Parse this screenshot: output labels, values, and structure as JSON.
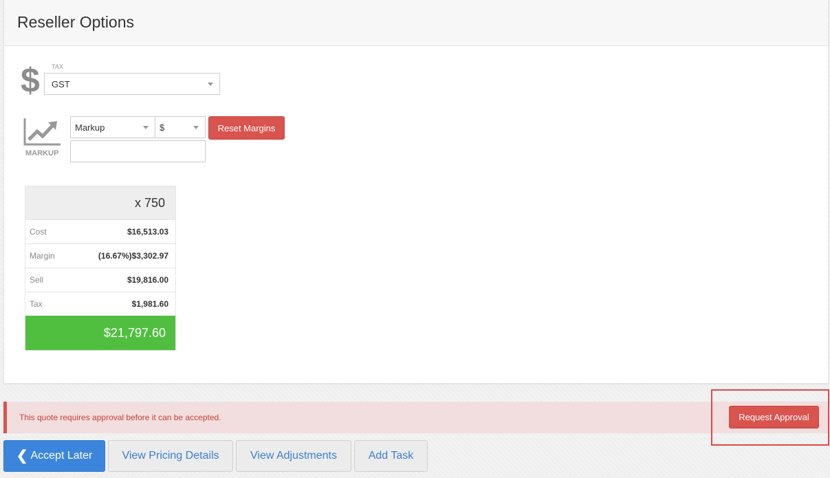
{
  "panel": {
    "title": "Reseller Options"
  },
  "tax": {
    "label": "TAX",
    "value": "GST"
  },
  "markup": {
    "label": "MARKUP",
    "type_value": "Markup",
    "currency_value": "$",
    "input_value": "",
    "reset_label": "Reset Margins"
  },
  "pricing": {
    "quantity": "x 750",
    "rows": [
      {
        "label": "Cost",
        "value": "$16,513.03"
      },
      {
        "label": "Margin",
        "value": "(16.67%)$3,302.97"
      },
      {
        "label": "Sell",
        "value": "$19,816.00"
      },
      {
        "label": "Tax",
        "value": "$1,981.60"
      }
    ],
    "total": "$21,797.60",
    "total_color": "#50bf40"
  },
  "alert": {
    "message": "This quote requires approval before it can be accepted.",
    "button_label": "Request Approval",
    "color": "#d9534f"
  },
  "actions": {
    "accept_later": "Accept Later",
    "view_pricing": "View Pricing Details",
    "view_adjustments": "View Adjustments",
    "add_task": "Add Task"
  },
  "icons": {
    "tax": "dollar-icon",
    "markup": "chart-trend-icon",
    "accept": "chevron-left-icon"
  }
}
